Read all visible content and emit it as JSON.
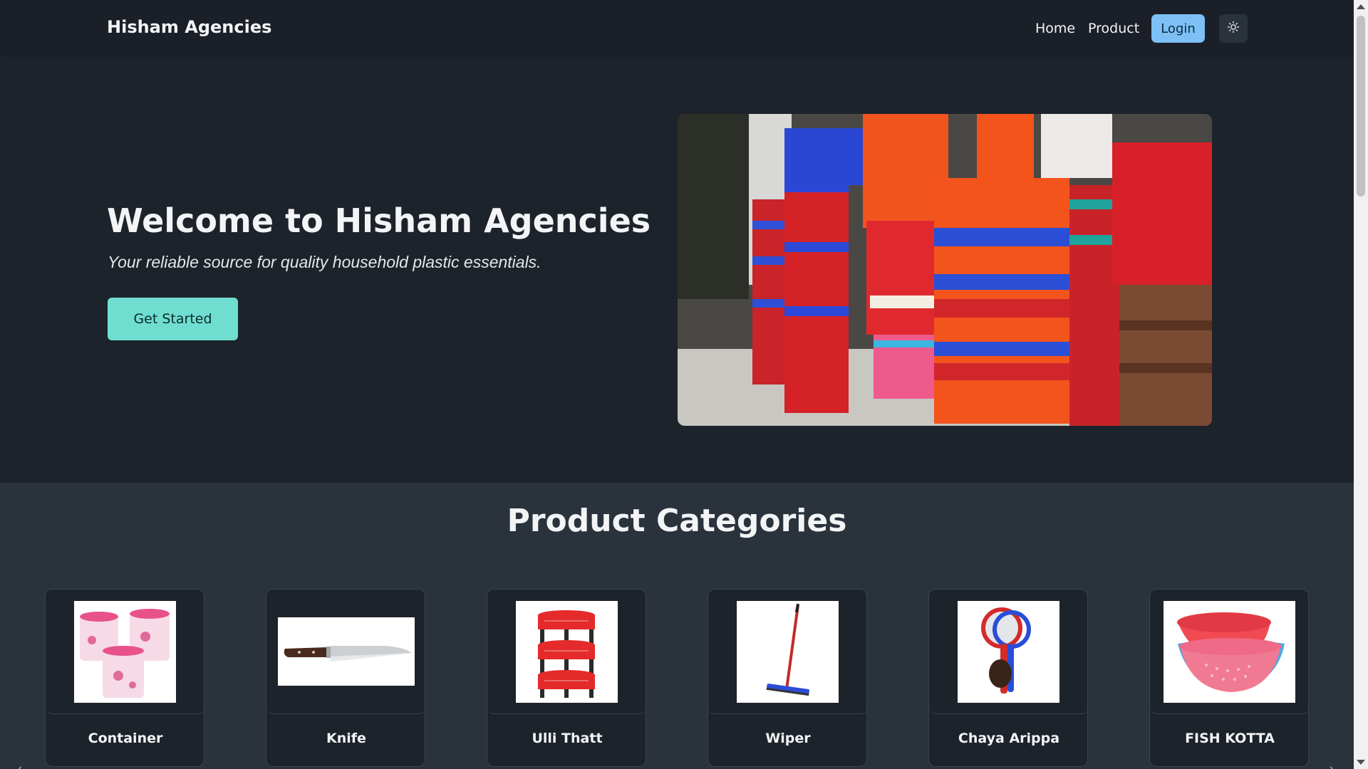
{
  "navbar": {
    "brand": "Hisham Agencies",
    "links": [
      {
        "label": "Home"
      },
      {
        "label": "Product"
      }
    ],
    "login_label": "Login",
    "theme_toggle_icon": "sun-icon"
  },
  "hero": {
    "title": "Welcome to Hisham Agencies",
    "subtitle": "Your reliable source for quality household plastic essentials.",
    "cta_label": "Get Started",
    "image_icon": "stacked-plastic-buckets-photo"
  },
  "categories": {
    "title": "Product Categories",
    "items": [
      {
        "label": "Container",
        "icon": "container-jars-image"
      },
      {
        "label": "Knife",
        "icon": "knife-image"
      },
      {
        "label": "Ulli Thatt",
        "icon": "tiered-basket-rack-image"
      },
      {
        "label": "Wiper",
        "icon": "floor-wiper-image"
      },
      {
        "label": "Chaya Arippa",
        "icon": "tea-strainer-image"
      },
      {
        "label": "FISH KOTTA",
        "icon": "colander-basket-image"
      }
    ]
  },
  "colors": {
    "page_bg": "#1d232a",
    "navbar_bg": "#1b2028",
    "section_bg": "#2a323c",
    "login_btn": "#7cc0f5",
    "cta_btn": "#6fded1"
  }
}
